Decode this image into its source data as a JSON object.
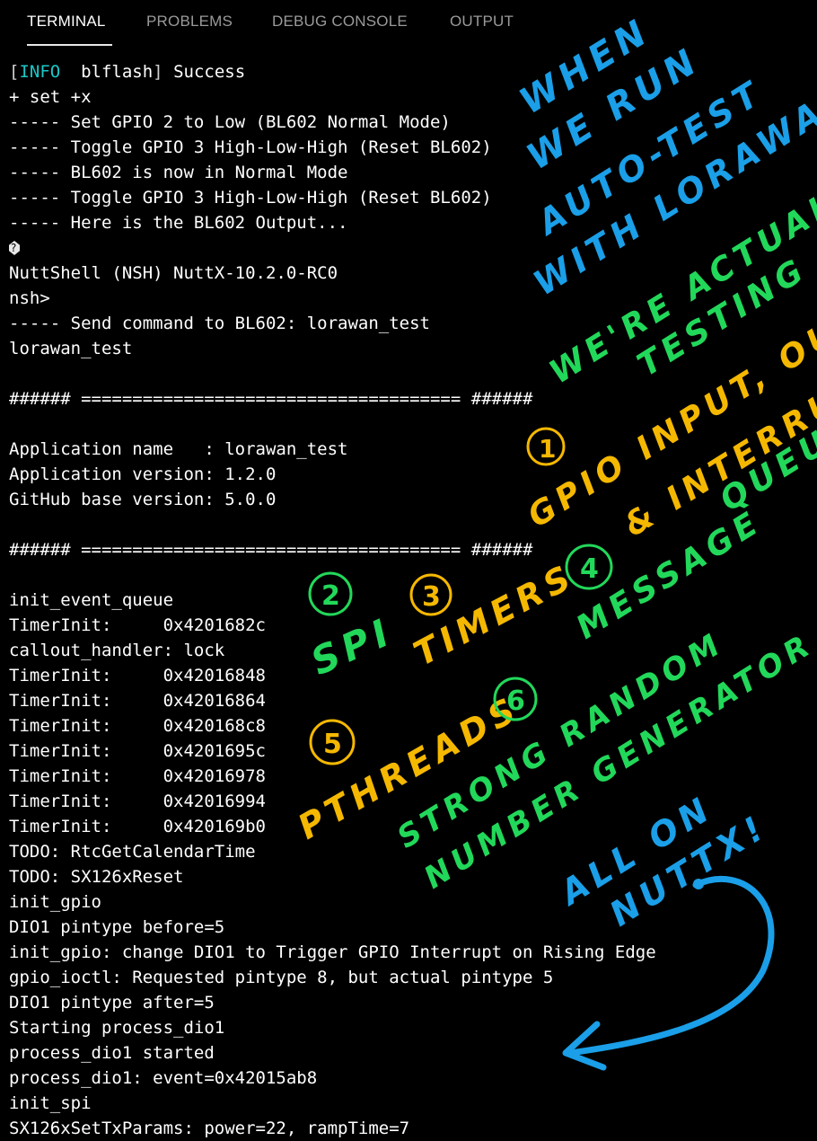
{
  "tabs": [
    {
      "label": "TERMINAL",
      "active": true
    },
    {
      "label": "PROBLEMS",
      "active": false
    },
    {
      "label": "DEBUG CONSOLE",
      "active": false
    },
    {
      "label": "OUTPUT",
      "active": false
    }
  ],
  "terminal": {
    "first_line": {
      "open": "[",
      "level": "INFO",
      "source": "  blflash",
      "close": "]",
      "message": " Success"
    },
    "lines": [
      "+ set +x",
      "----- Set GPIO 2 to Low (BL602 Normal Mode)",
      "----- Toggle GPIO 3 High-Low-High (Reset BL602)",
      "----- BL602 is now in Normal Mode",
      "----- Toggle GPIO 3 High-Low-High (Reset BL602)",
      "----- Here is the BL602 Output..."
    ],
    "lines2": [
      "NuttShell (NSH) NuttX-10.2.0-RC0",
      "nsh>",
      "----- Send command to BL602: lorawan_test",
      "lorawan_test",
      "",
      "###### ===================================== ######",
      "",
      "Application name   : lorawan_test",
      "Application version: 1.2.0",
      "GitHub base version: 5.0.0",
      "",
      "###### ===================================== ######",
      "",
      "init_event_queue",
      "TimerInit:     0x4201682c",
      "callout_handler: lock",
      "TimerInit:     0x42016848",
      "TimerInit:     0x42016864",
      "TimerInit:     0x420168c8",
      "TimerInit:     0x4201695c",
      "TimerInit:     0x42016978",
      "TimerInit:     0x42016994",
      "TimerInit:     0x420169b0",
      "TODO: RtcGetCalendarTime",
      "TODO: SX126xReset",
      "init_gpio",
      "DIO1 pintype before=5",
      "init_gpio: change DIO1 to Trigger GPIO Interrupt on Rising Edge",
      "gpio_ioctl: Requested pintype 8, but actual pintype 5",
      "DIO1 pintype after=5",
      "Starting process_dio1",
      "process_dio1 started",
      "process_dio1: event=0x42015ab8",
      "init_spi",
      "SX126xSetTxParams: power=22, rampTime=7"
    ]
  },
  "annotations": {
    "blue_1": "WHEN",
    "blue_2": "WE RUN",
    "blue_3": "AUTO-TEST",
    "blue_4": "WITH LORAWAN",
    "green_1": "WE'RE ACTUALLY",
    "green_2": "TESTING",
    "num_1": "1",
    "orange_gpio": "GPIO INPUT, OUTPUT",
    "orange_int": "& INTERRUPT",
    "green_mq1": "MESSAGE",
    "green_mq2": "QUEUE",
    "num_2": "2",
    "num_3": "3",
    "num_4": "4",
    "num_5": "5",
    "num_6": "6",
    "green_spi": "SPI",
    "orange_timers": "TIMERS",
    "orange_pthreads": "PTHREADS",
    "green_rng1": "STRONG RANDOM",
    "green_rng2": "NUMBER GENERATOR",
    "blue_all": "ALL ON",
    "blue_nuttx": "NUTTX!"
  },
  "colors": {
    "blue": "#1a9fe8",
    "green": "#22d85a",
    "orange": "#f5b800",
    "info": "#19c8c8"
  }
}
